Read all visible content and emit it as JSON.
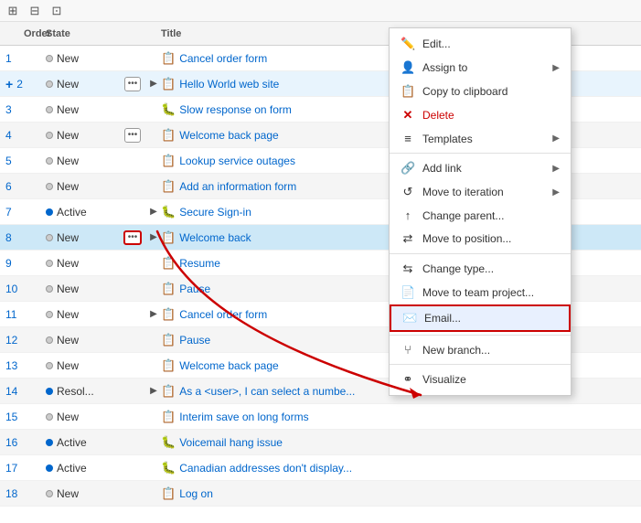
{
  "toolbar": {
    "icons": [
      "⊞",
      "⊟",
      "⊡"
    ]
  },
  "header": {
    "col_order": "Order",
    "col_state": "State",
    "col_title": "Title"
  },
  "rows": [
    {
      "id": 1,
      "order": "1",
      "state": "New",
      "dot": "new",
      "has_dots": false,
      "has_arrow": false,
      "icon": "📋",
      "title": "Cancel order form"
    },
    {
      "id": 2,
      "order": "2",
      "state": "New",
      "dot": "new",
      "has_dots": true,
      "has_arrow": true,
      "icon": "📋",
      "title": "Hello World web site",
      "add_plus": true
    },
    {
      "id": 3,
      "order": "3",
      "state": "New",
      "dot": "new",
      "has_dots": false,
      "has_arrow": false,
      "icon": "🐛",
      "title": "Slow response on form"
    },
    {
      "id": 4,
      "order": "4",
      "state": "New",
      "dot": "new",
      "has_dots": true,
      "has_arrow": false,
      "icon": "📋",
      "title": "Welcome back page"
    },
    {
      "id": 5,
      "order": "5",
      "state": "New",
      "dot": "new",
      "has_dots": false,
      "has_arrow": false,
      "icon": "📋",
      "title": "Lookup service outages"
    },
    {
      "id": 6,
      "order": "6",
      "state": "New",
      "dot": "new",
      "has_dots": false,
      "has_arrow": false,
      "icon": "📋",
      "title": "Add an information form"
    },
    {
      "id": 7,
      "order": "7",
      "state": "Active",
      "dot": "active",
      "has_dots": false,
      "has_arrow": true,
      "icon": "🐛",
      "title": "Secure Sign-in"
    },
    {
      "id": 8,
      "order": "8",
      "state": "New",
      "dot": "new",
      "has_dots": true,
      "has_arrow": true,
      "icon": "📋",
      "title": "Welcome back",
      "highlighted": true
    },
    {
      "id": 9,
      "order": "9",
      "state": "New",
      "dot": "new",
      "has_dots": false,
      "has_arrow": false,
      "icon": "📋",
      "title": "Resume"
    },
    {
      "id": 10,
      "order": "10",
      "state": "New",
      "dot": "new",
      "has_dots": false,
      "has_arrow": false,
      "icon": "📋",
      "title": "Pause"
    },
    {
      "id": 11,
      "order": "11",
      "state": "New",
      "dot": "new",
      "has_dots": false,
      "has_arrow": true,
      "icon": "📋",
      "title": "Cancel order form"
    },
    {
      "id": 12,
      "order": "12",
      "state": "New",
      "dot": "new",
      "has_dots": false,
      "has_arrow": false,
      "icon": "📋",
      "title": "Pause"
    },
    {
      "id": 13,
      "order": "13",
      "state": "New",
      "dot": "new",
      "has_dots": false,
      "has_arrow": false,
      "icon": "📋",
      "title": "Welcome back page"
    },
    {
      "id": 14,
      "order": "14",
      "state": "Resol...",
      "dot": "active",
      "has_dots": false,
      "has_arrow": true,
      "icon": "📋",
      "title": "As a <user>, I can select a numbe..."
    },
    {
      "id": 15,
      "order": "15",
      "state": "New",
      "dot": "new",
      "has_dots": false,
      "has_arrow": false,
      "icon": "📋",
      "title": "Interim save on long forms"
    },
    {
      "id": 16,
      "order": "16",
      "state": "Active",
      "dot": "active",
      "has_dots": false,
      "has_arrow": false,
      "icon": "🐛",
      "title": "Voicemail hang issue"
    },
    {
      "id": 17,
      "order": "17",
      "state": "Active",
      "dot": "active",
      "has_dots": false,
      "has_arrow": false,
      "icon": "🐛",
      "title": "Canadian addresses don't display..."
    },
    {
      "id": 18,
      "order": "18",
      "state": "New",
      "dot": "new",
      "has_dots": false,
      "has_arrow": false,
      "icon": "📋",
      "title": "Log on"
    }
  ],
  "context_menu": {
    "items": [
      {
        "id": "edit",
        "label": "Edit...",
        "icon": "✏️",
        "has_arrow": false,
        "type": "normal"
      },
      {
        "id": "assign",
        "label": "Assign to",
        "icon": "👤",
        "has_arrow": true,
        "type": "normal"
      },
      {
        "id": "copy",
        "label": "Copy to clipboard",
        "icon": "📋",
        "has_arrow": false,
        "type": "normal"
      },
      {
        "id": "delete",
        "label": "Delete",
        "icon": "✕",
        "has_arrow": false,
        "type": "delete"
      },
      {
        "id": "templates",
        "label": "Templates",
        "icon": "≡",
        "has_arrow": true,
        "type": "normal"
      },
      {
        "id": "sep1",
        "type": "separator"
      },
      {
        "id": "addlink",
        "label": "Add link",
        "icon": "🔗",
        "has_arrow": true,
        "type": "normal"
      },
      {
        "id": "moveiteration",
        "label": "Move to iteration",
        "icon": "↺",
        "has_arrow": true,
        "type": "normal"
      },
      {
        "id": "changeparent",
        "label": "Change parent...",
        "icon": "↑",
        "has_arrow": false,
        "type": "normal"
      },
      {
        "id": "moveposition",
        "label": "Move to position...",
        "icon": "⇄",
        "has_arrow": false,
        "type": "normal"
      },
      {
        "id": "sep2",
        "type": "separator"
      },
      {
        "id": "changetype",
        "label": "Change type...",
        "icon": "⇆",
        "has_arrow": false,
        "type": "normal"
      },
      {
        "id": "movetoteam",
        "label": "Move to team project...",
        "icon": "📄",
        "has_arrow": false,
        "type": "normal"
      },
      {
        "id": "email",
        "label": "Email...",
        "icon": "✉️",
        "has_arrow": false,
        "type": "highlighted"
      },
      {
        "id": "sep3",
        "type": "separator"
      },
      {
        "id": "newbranch",
        "label": "New branch...",
        "icon": "⑂",
        "has_arrow": false,
        "type": "normal"
      },
      {
        "id": "sep4",
        "type": "separator"
      },
      {
        "id": "visualize",
        "label": "Visualize",
        "icon": "⚭",
        "has_arrow": false,
        "type": "normal"
      }
    ]
  }
}
